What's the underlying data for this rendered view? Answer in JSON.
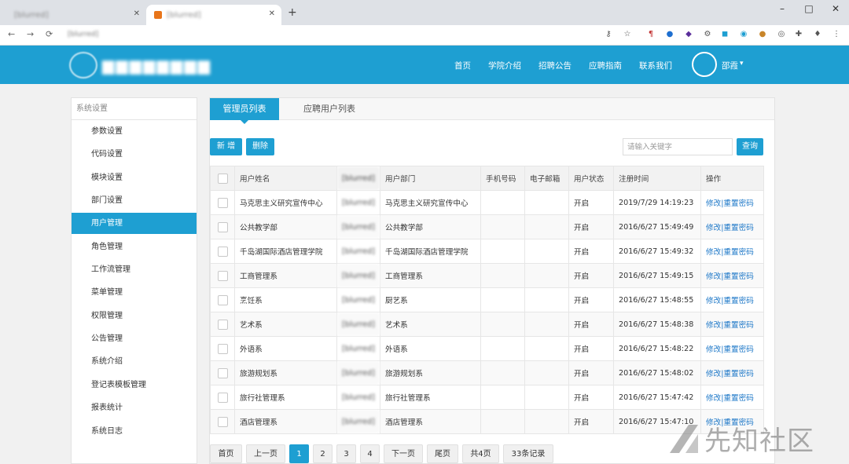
{
  "browser": {
    "tabs": [
      {
        "title": "[blurred]",
        "active": false
      },
      {
        "title": "[blurred]",
        "active": true
      }
    ],
    "url": "[blurred]",
    "window_controls": {
      "minimize": "–",
      "maximize": "□",
      "close": "✕"
    }
  },
  "site": {
    "nav": [
      "首页",
      "学院介绍",
      "招聘公告",
      "应聘指南",
      "联系我们"
    ],
    "user": {
      "name": "邵霞",
      "caret": "▾"
    }
  },
  "sidebar": {
    "title": "系统设置",
    "items": [
      {
        "label": "参数设置"
      },
      {
        "label": "代码设置"
      },
      {
        "label": "模块设置"
      },
      {
        "label": "部门设置"
      },
      {
        "label": "用户管理",
        "active": true
      },
      {
        "label": "角色管理"
      },
      {
        "label": "工作流管理"
      },
      {
        "label": "菜单管理"
      },
      {
        "label": "权限管理"
      },
      {
        "label": "公告管理"
      },
      {
        "label": "系统介绍"
      },
      {
        "label": "登记表模板管理"
      },
      {
        "label": "报表统计"
      },
      {
        "label": "系统日志"
      }
    ]
  },
  "main": {
    "tabs": [
      {
        "label": "管理员列表",
        "active": true
      },
      {
        "label": "应聘用户列表",
        "active": false
      }
    ],
    "actions": {
      "add": "新 增",
      "delete": "删除"
    },
    "search": {
      "placeholder": "请输入关键字",
      "button": "查询"
    },
    "table": {
      "headers": [
        "用户姓名",
        "[blurred]",
        "用户部门",
        "手机号码",
        "电子邮箱",
        "用户状态",
        "注册时间",
        "操作"
      ],
      "rows": [
        {
          "name": "马克思主义研究宣传中心",
          "login": "[blurred]",
          "dept": "马克思主义研究宣传中心",
          "phone": "",
          "email": "",
          "status": "开启",
          "time": "2019/7/29 14:19:23"
        },
        {
          "name": "公共教学部",
          "login": "[blurred]",
          "dept": "公共教学部",
          "phone": "",
          "email": "",
          "status": "开启",
          "time": "2016/6/27 15:49:49"
        },
        {
          "name": "千岛湖国际酒店管理学院",
          "login": "[blurred]",
          "dept": "千岛湖国际酒店管理学院",
          "phone": "",
          "email": "",
          "status": "开启",
          "time": "2016/6/27 15:49:32"
        },
        {
          "name": "工商管理系",
          "login": "[blurred]",
          "dept": "工商管理系",
          "phone": "",
          "email": "",
          "status": "开启",
          "time": "2016/6/27 15:49:15"
        },
        {
          "name": "烹饪系",
          "login": "[blurred]",
          "dept": "厨艺系",
          "phone": "",
          "email": "",
          "status": "开启",
          "time": "2016/6/27 15:48:55"
        },
        {
          "name": "艺术系",
          "login": "[blurred]",
          "dept": "艺术系",
          "phone": "",
          "email": "",
          "status": "开启",
          "time": "2016/6/27 15:48:38"
        },
        {
          "name": "外语系",
          "login": "[blurred]",
          "dept": "外语系",
          "phone": "",
          "email": "",
          "status": "开启",
          "time": "2016/6/27 15:48:22"
        },
        {
          "name": "旅游规划系",
          "login": "[blurred]",
          "dept": "旅游规划系",
          "phone": "",
          "email": "",
          "status": "开启",
          "time": "2016/6/27 15:48:02"
        },
        {
          "name": "旅行社管理系",
          "login": "[blurred]",
          "dept": "旅行社管理系",
          "phone": "",
          "email": "",
          "status": "开启",
          "time": "2016/6/27 15:47:42"
        },
        {
          "name": "酒店管理系",
          "login": "[blurred]",
          "dept": "酒店管理系",
          "phone": "",
          "email": "",
          "status": "开启",
          "time": "2016/6/27 15:47:10"
        }
      ],
      "op_edit": "修改",
      "op_sep": "|",
      "op_reset": "重置密码"
    },
    "pagination": {
      "first": "首页",
      "prev": "上一页",
      "pages": [
        "1",
        "2",
        "3",
        "4"
      ],
      "current": "1",
      "next": "下一页",
      "last": "尾页",
      "total_pages": "共4页",
      "total_records": "33条记录"
    }
  },
  "watermark": {
    "text": "先知社区"
  },
  "colors": {
    "primary": "#1e9fd2",
    "link": "#1e78c8"
  }
}
